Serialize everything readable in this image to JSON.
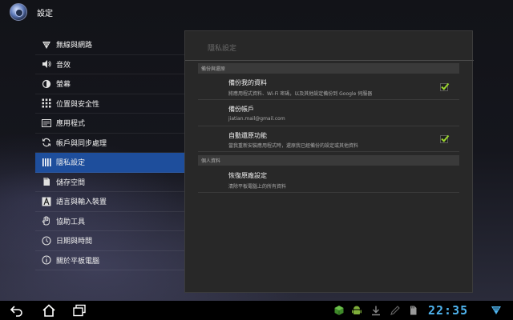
{
  "header": {
    "title": "設定"
  },
  "sidebar": {
    "items": [
      {
        "label": "無線與網路",
        "icon": "wifi-icon"
      },
      {
        "label": "音效",
        "icon": "speaker-icon"
      },
      {
        "label": "螢幕",
        "icon": "brightness-icon"
      },
      {
        "label": "位置與安全性",
        "icon": "location-grid-icon"
      },
      {
        "label": "應用程式",
        "icon": "apps-icon"
      },
      {
        "label": "帳戶與同步處理",
        "icon": "sync-icon"
      },
      {
        "label": "隱私設定",
        "icon": "privacy-icon",
        "active": true
      },
      {
        "label": "儲存空間",
        "icon": "storage-icon"
      },
      {
        "label": "語言與輸入裝置",
        "icon": "language-icon"
      },
      {
        "label": "協助工具",
        "icon": "hand-icon"
      },
      {
        "label": "日期與時間",
        "icon": "clock-icon"
      },
      {
        "label": "關於平板電腦",
        "icon": "info-icon"
      }
    ]
  },
  "panel": {
    "title": "隱私設定",
    "sections": [
      {
        "header": "備份與還原"
      },
      {
        "header": "個人資料"
      }
    ],
    "prefs": {
      "backup": {
        "title": "備份我的資料",
        "summary": "將應用程式資料、Wi-Fi 密碼，以及其他設定備份到 Google 伺服器",
        "checked": true
      },
      "account": {
        "title": "備份帳戶",
        "summary": "jiatian.mail@gmail.com"
      },
      "restore": {
        "title": "自動還原功能",
        "summary": "當我重新安裝應用程式時，還原我已經備份的設定或其他資料",
        "checked": true
      },
      "factory": {
        "title": "恢復原廠設定",
        "summary": "清除平板電腦上的所有資料"
      }
    }
  },
  "statusbar": {
    "clock": "22:35",
    "accent": "#4fb4ef"
  }
}
